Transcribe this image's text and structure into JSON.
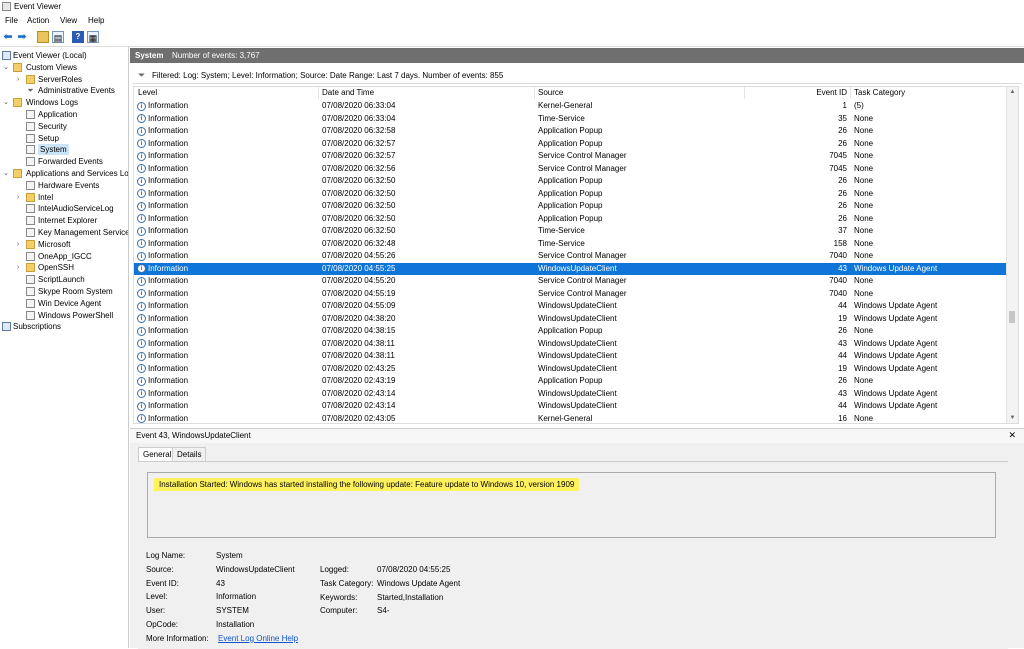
{
  "window": {
    "title": "Event Viewer"
  },
  "menu": [
    "File",
    "Action",
    "View",
    "Help"
  ],
  "tree": [
    {
      "label": "Event Viewer (Local)",
      "level": 0,
      "expand": "",
      "icon": "ev"
    },
    {
      "label": "Custom Views",
      "level": 1,
      "expand": "v",
      "icon": "folder"
    },
    {
      "label": "ServerRoles",
      "level": 2,
      "expand": ">",
      "icon": "folder"
    },
    {
      "label": "Administrative Events",
      "level": 2,
      "expand": "",
      "icon": "filter"
    },
    {
      "label": "Windows Logs",
      "level": 1,
      "expand": "v",
      "icon": "folder"
    },
    {
      "label": "Application",
      "level": 2,
      "expand": "",
      "icon": "log"
    },
    {
      "label": "Security",
      "level": 2,
      "expand": "",
      "icon": "log"
    },
    {
      "label": "Setup",
      "level": 2,
      "expand": "",
      "icon": "log"
    },
    {
      "label": "System",
      "level": 2,
      "expand": "",
      "icon": "log",
      "selected": true
    },
    {
      "label": "Forwarded Events",
      "level": 2,
      "expand": "",
      "icon": "log"
    },
    {
      "label": "Applications and Services Lo",
      "level": 1,
      "expand": "v",
      "icon": "folder"
    },
    {
      "label": "Hardware Events",
      "level": 2,
      "expand": "",
      "icon": "log"
    },
    {
      "label": "Intel",
      "level": 2,
      "expand": ">",
      "icon": "folder"
    },
    {
      "label": "IntelAudioServiceLog",
      "level": 2,
      "expand": "",
      "icon": "log"
    },
    {
      "label": "Internet Explorer",
      "level": 2,
      "expand": "",
      "icon": "log"
    },
    {
      "label": "Key Management Service",
      "level": 2,
      "expand": "",
      "icon": "log"
    },
    {
      "label": "Microsoft",
      "level": 2,
      "expand": ">",
      "icon": "folder"
    },
    {
      "label": "OneApp_IGCC",
      "level": 2,
      "expand": "",
      "icon": "log"
    },
    {
      "label": "OpenSSH",
      "level": 2,
      "expand": ">",
      "icon": "folder"
    },
    {
      "label": "ScriptLaunch",
      "level": 2,
      "expand": "",
      "icon": "log"
    },
    {
      "label": "Skype Room System",
      "level": 2,
      "expand": "",
      "icon": "log"
    },
    {
      "label": "Win Device Agent",
      "level": 2,
      "expand": "",
      "icon": "log"
    },
    {
      "label": "Windows PowerShell",
      "level": 2,
      "expand": "",
      "icon": "log"
    },
    {
      "label": "Subscriptions",
      "level": 0,
      "expand": "",
      "icon": "ev"
    }
  ],
  "header": {
    "name": "System",
    "count": "Number of events: 3,767"
  },
  "filter": "Filtered: Log: System; Level: Information; Source: Date Range: Last 7 days. Number of events: 855",
  "columns": [
    "Level",
    "Date and Time",
    "Source",
    "Event ID",
    "Task Category"
  ],
  "events": [
    [
      "Information",
      "07/08/2020 06:33:04",
      "Kernel-General",
      "1",
      "(5)"
    ],
    [
      "Information",
      "07/08/2020 06:33:04",
      "Time-Service",
      "35",
      "None"
    ],
    [
      "Information",
      "07/08/2020 06:32:58",
      "Application Popup",
      "26",
      "None"
    ],
    [
      "Information",
      "07/08/2020 06:32:57",
      "Application Popup",
      "26",
      "None"
    ],
    [
      "Information",
      "07/08/2020 06:32:57",
      "Service Control Manager",
      "7045",
      "None"
    ],
    [
      "Information",
      "07/08/2020 06:32:56",
      "Service Control Manager",
      "7045",
      "None"
    ],
    [
      "Information",
      "07/08/2020 06:32:50",
      "Application Popup",
      "26",
      "None"
    ],
    [
      "Information",
      "07/08/2020 06:32:50",
      "Application Popup",
      "26",
      "None"
    ],
    [
      "Information",
      "07/08/2020 06:32:50",
      "Application Popup",
      "26",
      "None"
    ],
    [
      "Information",
      "07/08/2020 06:32:50",
      "Application Popup",
      "26",
      "None"
    ],
    [
      "Information",
      "07/08/2020 06:32:50",
      "Time-Service",
      "37",
      "None"
    ],
    [
      "Information",
      "07/08/2020 06:32:48",
      "Time-Service",
      "158",
      "None"
    ],
    [
      "Information",
      "07/08/2020 04:55:26",
      "Service Control Manager",
      "7040",
      "None"
    ],
    [
      "Information",
      "07/08/2020 04:55:25",
      "WindowsUpdateClient",
      "43",
      "Windows Update Agent"
    ],
    [
      "Information",
      "07/08/2020 04:55:20",
      "Service Control Manager",
      "7040",
      "None"
    ],
    [
      "Information",
      "07/08/2020 04:55:19",
      "Service Control Manager",
      "7040",
      "None"
    ],
    [
      "Information",
      "07/08/2020 04:55:09",
      "WindowsUpdateClient",
      "44",
      "Windows Update Agent"
    ],
    [
      "Information",
      "07/08/2020 04:38:20",
      "WindowsUpdateClient",
      "19",
      "Windows Update Agent"
    ],
    [
      "Information",
      "07/08/2020 04:38:15",
      "Application Popup",
      "26",
      "None"
    ],
    [
      "Information",
      "07/08/2020 04:38:11",
      "WindowsUpdateClient",
      "43",
      "Windows Update Agent"
    ],
    [
      "Information",
      "07/08/2020 04:38:11",
      "WindowsUpdateClient",
      "44",
      "Windows Update Agent"
    ],
    [
      "Information",
      "07/08/2020 02:43:25",
      "WindowsUpdateClient",
      "19",
      "Windows Update Agent"
    ],
    [
      "Information",
      "07/08/2020 02:43:19",
      "Application Popup",
      "26",
      "None"
    ],
    [
      "Information",
      "07/08/2020 02:43:14",
      "WindowsUpdateClient",
      "43",
      "Windows Update Agent"
    ],
    [
      "Information",
      "07/08/2020 02:43:14",
      "WindowsUpdateClient",
      "44",
      "Windows Update Agent"
    ],
    [
      "Information",
      "07/08/2020 02:43:05",
      "Kernel-General",
      "16",
      "None"
    ]
  ],
  "selected_row": 13,
  "detail": {
    "heading": "Event 43, WindowsUpdateClient",
    "tabs": [
      "General",
      "Details"
    ],
    "message": "Installation Started: Windows has started installing the following update: Feature update to Windows 10, version 1909",
    "props_left": [
      {
        "label": "Log Name:",
        "value": "System"
      },
      {
        "label": "Source:",
        "value": "WindowsUpdateClient"
      },
      {
        "label": "Event ID:",
        "value": "43"
      },
      {
        "label": "Level:",
        "value": "Information"
      },
      {
        "label": "User:",
        "value": "SYSTEM"
      },
      {
        "label": "OpCode:",
        "value": "Installation"
      },
      {
        "label": "More Information:",
        "value": "Event Log Online Help"
      }
    ],
    "props_right": [
      {
        "label": "Logged:",
        "value": "07/08/2020 04:55:25"
      },
      {
        "label": "Task Category:",
        "value": "Windows Update Agent"
      },
      {
        "label": "Keywords:",
        "value": "Started,Installation"
      },
      {
        "label": "Computer:",
        "value": "S4-"
      }
    ]
  },
  "colors": {
    "selection": "#0f75d8",
    "header_bar": "#6f6f6f",
    "highlight": "#fff25f"
  }
}
